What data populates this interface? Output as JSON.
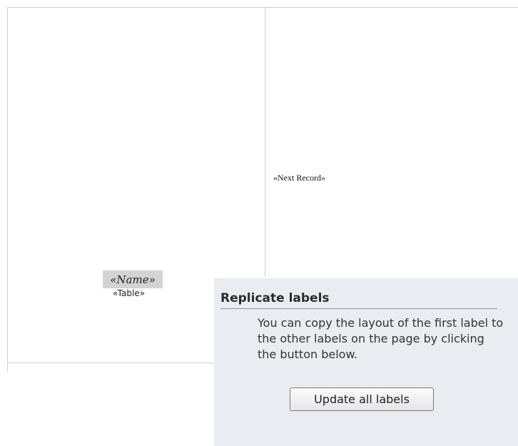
{
  "labels_document": {
    "next_record_field": "«Next Record»",
    "name_field": "«Name»",
    "table_field": "«Table»"
  },
  "replicate_labels": {
    "title": "Replicate labels",
    "description": "You can copy the layout of the first label to the other labels on the page by clicking the button below.",
    "button_label": "Update all labels"
  }
}
